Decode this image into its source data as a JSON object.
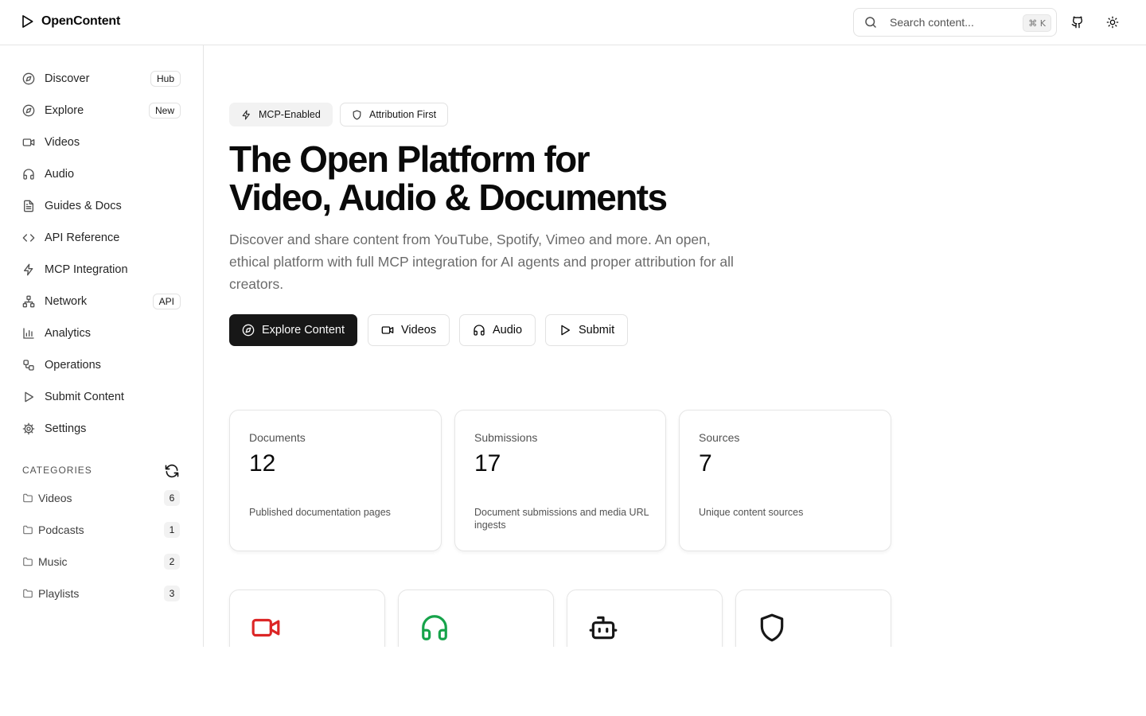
{
  "brand": {
    "name": "OpenContent",
    "icon": "play-icon"
  },
  "header": {
    "search_placeholder": "Search content...",
    "search_shortcut": "⌘ K",
    "github_icon": "github-icon",
    "theme_icon": "sun-icon"
  },
  "sidebar": {
    "items": [
      {
        "label": "Discover",
        "icon": "compass-icon",
        "badge": "Hub"
      },
      {
        "label": "Explore",
        "icon": "compass-icon",
        "badge": "New"
      },
      {
        "label": "Videos",
        "icon": "video-icon"
      },
      {
        "label": "Audio",
        "icon": "headphones-icon"
      },
      {
        "label": "Guides & Docs",
        "icon": "file-text-icon"
      },
      {
        "label": "API Reference",
        "icon": "code-icon"
      },
      {
        "label": "MCP Integration",
        "icon": "zap-icon"
      },
      {
        "label": "Network",
        "icon": "network-icon",
        "badge": "API"
      },
      {
        "label": "Analytics",
        "icon": "bar-chart-icon"
      },
      {
        "label": "Operations",
        "icon": "workflow-icon"
      },
      {
        "label": "Submit Content",
        "icon": "play-icon"
      },
      {
        "label": "Settings",
        "icon": "gear-icon"
      }
    ],
    "categories_title": "CATEGORIES",
    "categories": [
      {
        "label": "Videos",
        "count": "6"
      },
      {
        "label": "Podcasts",
        "count": "1"
      },
      {
        "label": "Music",
        "count": "2"
      },
      {
        "label": "Playlists",
        "count": "3"
      }
    ]
  },
  "hero": {
    "pills": [
      {
        "label": "MCP-Enabled",
        "icon": "zap-icon"
      },
      {
        "label": "Attribution First",
        "icon": "shield-icon"
      }
    ],
    "title_line1": "The Open Platform for",
    "title_line2": "Video, Audio & Documents",
    "description": "Discover and share content from YouTube, Spotify, Vimeo and more. An open, ethical platform with full MCP integration for AI agents and proper attribution for all creators.",
    "buttons": [
      {
        "label": "Explore Content",
        "icon": "compass-icon"
      },
      {
        "label": "Videos",
        "icon": "video-icon"
      },
      {
        "label": "Audio",
        "icon": "headphones-icon"
      },
      {
        "label": "Submit",
        "icon": "play-icon"
      }
    ]
  },
  "stats": [
    {
      "label": "Documents",
      "value": "12",
      "description": "Published documentation pages"
    },
    {
      "label": "Submissions",
      "value": "17",
      "description": "Document submissions and media URL ingests"
    },
    {
      "label": "Sources",
      "value": "7",
      "description": "Unique content sources"
    }
  ],
  "features": [
    {
      "icon": "video-icon",
      "color": "#dc2626"
    },
    {
      "icon": "headphones-icon",
      "color": "#16a34a"
    },
    {
      "icon": "bot-icon",
      "color": "#171717"
    },
    {
      "icon": "shield-icon",
      "color": "#171717"
    }
  ]
}
